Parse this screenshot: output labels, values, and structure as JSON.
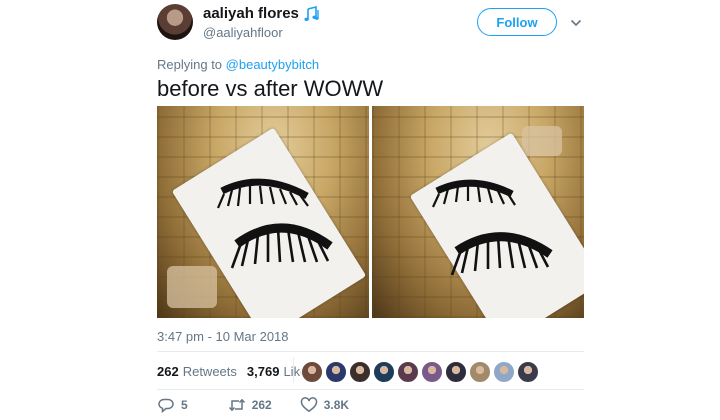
{
  "author": {
    "display_name": "aaliyah flores",
    "handle": "@aaliyahfloor",
    "badge_icon": "music-notes-icon"
  },
  "follow_label": "Follow",
  "reply": {
    "prefix": "Replying to",
    "target": "@beautybybitch"
  },
  "tweet_text": "before vs after WOWW",
  "timestamp": "3:47 pm - 10 Mar 2018",
  "stats": {
    "retweets_count": "262",
    "retweets_label": "Retweets",
    "likes_count": "3,769",
    "likes_label": "Likes"
  },
  "actions": {
    "reply_count": "5",
    "retweet_count": "262",
    "like_count": "3.8K"
  },
  "colors": {
    "accent": "#1da1f2",
    "secondary_text": "#657786"
  },
  "likers": [
    "#6d4a3c",
    "#2b3a6b",
    "#3a2f2a",
    "#1e3d5a",
    "#5a3b4e",
    "#7a5a8a",
    "#2d2d3d",
    "#a08a6a",
    "#8fa8c8",
    "#3b3b4b"
  ]
}
